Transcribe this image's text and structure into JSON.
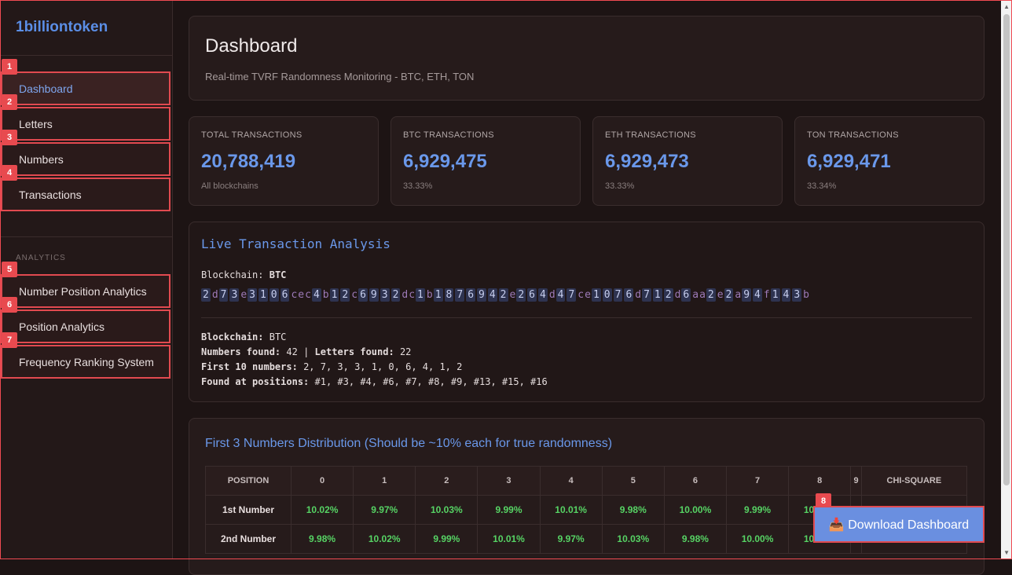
{
  "sidebar": {
    "brand": "1billiontoken",
    "items": [
      {
        "badge": "1",
        "label": "Dashboard"
      },
      {
        "badge": "2",
        "label": "Letters"
      },
      {
        "badge": "3",
        "label": "Numbers"
      },
      {
        "badge": "4",
        "label": "Transactions"
      }
    ],
    "section_label": "ANALYTICS",
    "analytics_items": [
      {
        "badge": "5",
        "label": "Number Position Analytics"
      },
      {
        "badge": "6",
        "label": "Position Analytics"
      },
      {
        "badge": "7",
        "label": "Frequency Ranking System"
      }
    ]
  },
  "header": {
    "title": "Dashboard",
    "subtitle": "Real-time TVRF Randomness Monitoring - BTC, ETH, TON"
  },
  "stats": [
    {
      "label": "TOTAL TRANSACTIONS",
      "value": "20,788,419",
      "sub": "All blockchains"
    },
    {
      "label": "BTC TRANSACTIONS",
      "value": "6,929,475",
      "sub": "33.33%"
    },
    {
      "label": "ETH TRANSACTIONS",
      "value": "6,929,473",
      "sub": "33.33%"
    },
    {
      "label": "TON TRANSACTIONS",
      "value": "6,929,471",
      "sub": "33.34%"
    }
  ],
  "live": {
    "title": "Live Transaction Analysis",
    "blockchain_label": "Blockchain:",
    "blockchain_value": "BTC",
    "hash": "2d73e3106cec4b12c6932dc1b187694 2e264d47ce10 76d712d6aa2e2a94f143b",
    "info": {
      "blockchain_label": "Blockchain:",
      "blockchain_value": "BTC",
      "numbers_label": "Numbers found:",
      "numbers_value": "42",
      "sep": "|",
      "letters_label": "Letters found:",
      "letters_value": "22",
      "first10_label": "First 10 numbers:",
      "first10_value": "2, 7, 3, 3, 1, 0, 6, 4, 1, 2",
      "positions_label": "Found at positions:",
      "positions_value": "#1, #3, #4, #6, #7, #8, #9, #13, #15, #16"
    }
  },
  "distribution": {
    "title": "First 3 Numbers Distribution (Should be ~10% each for true randomness)",
    "headers": [
      "POSITION",
      "0",
      "1",
      "2",
      "3",
      "4",
      "5",
      "6",
      "7",
      "8",
      "9",
      "CHI-SQUARE"
    ],
    "rows": [
      {
        "position": "1st Number",
        "values": [
          "10.02%",
          "9.97%",
          "10.03%",
          "9.99%",
          "10.01%",
          "9.98%",
          "10.00%",
          "9.99%",
          "10.01%",
          "",
          ""
        ]
      },
      {
        "position": "2nd Number",
        "values": [
          "9.98%",
          "10.02%",
          "9.99%",
          "10.01%",
          "9.97%",
          "10.03%",
          "9.98%",
          "10.00%",
          "10.02%",
          "",
          ""
        ]
      }
    ]
  },
  "download": {
    "badge": "8",
    "label": "📥 Download Dashboard"
  },
  "colors": {
    "accent": "#6a98ea",
    "danger": "#e14a50",
    "positive": "#56d364"
  }
}
